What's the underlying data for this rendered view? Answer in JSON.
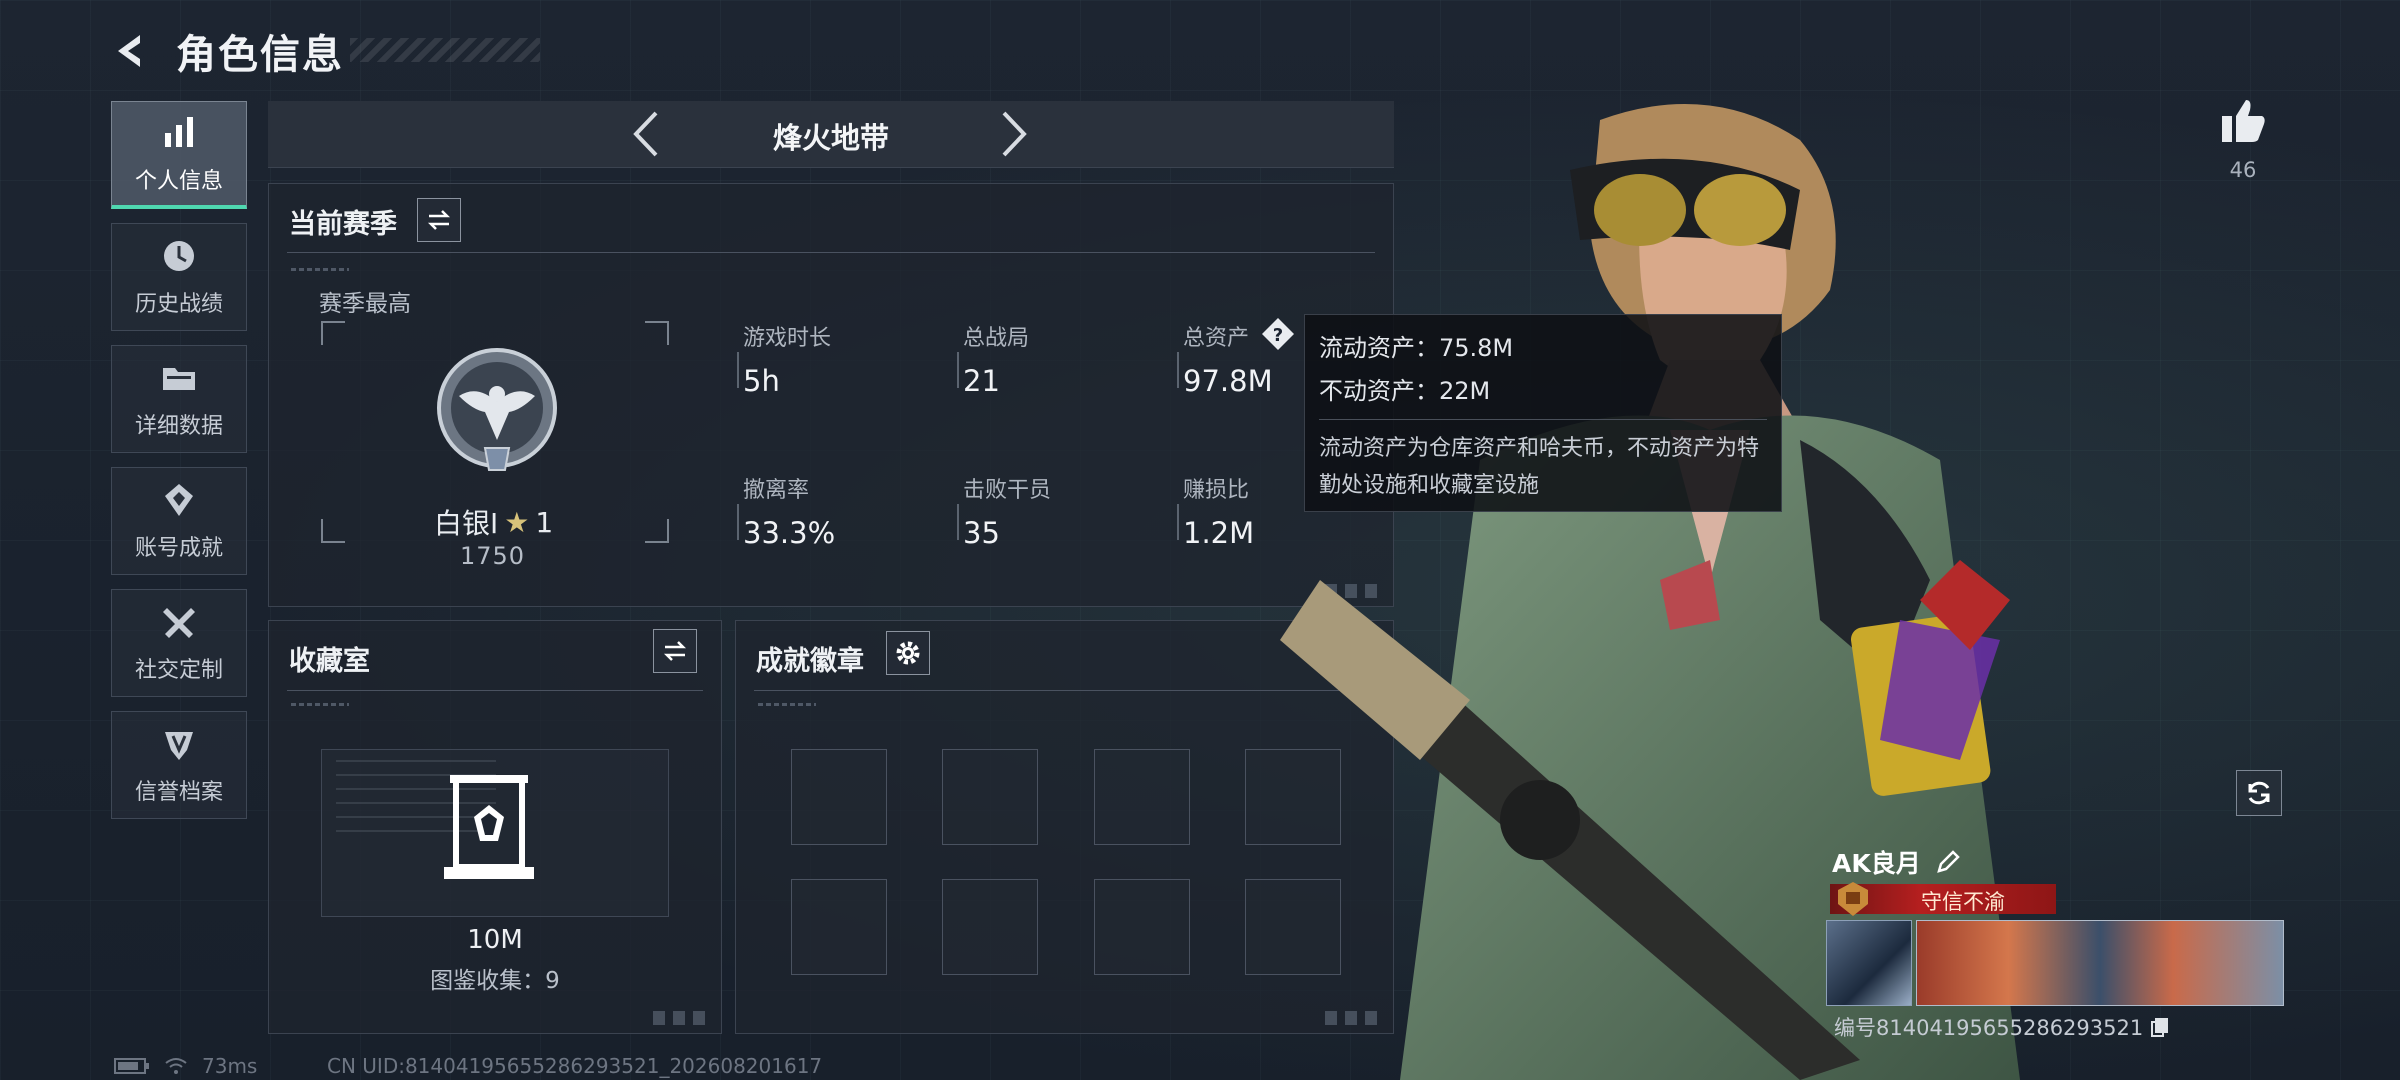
{
  "header": {
    "title": "角色信息"
  },
  "sidebar": {
    "items": [
      {
        "label": "个人信息",
        "icon": "bar-chart-icon",
        "active": true
      },
      {
        "label": "历史战绩",
        "icon": "history-icon",
        "active": false
      },
      {
        "label": "详细数据",
        "icon": "folder-icon",
        "active": false
      },
      {
        "label": "账号成就",
        "icon": "achievement-icon",
        "active": false
      },
      {
        "label": "社交定制",
        "icon": "tools-icon",
        "active": false
      },
      {
        "label": "信誉档案",
        "icon": "credit-icon",
        "active": false
      }
    ]
  },
  "mode": {
    "title": "烽火地带"
  },
  "season": {
    "title": "当前赛季",
    "best_label": "赛季最高",
    "rank_name": "白银I",
    "rank_stars": "1",
    "rank_score": "1750",
    "stats": [
      {
        "label": "游戏时长",
        "value": "5h"
      },
      {
        "label": "总战局",
        "value": "21"
      },
      {
        "label": "总资产",
        "value": "97.8M"
      },
      {
        "label": "撤离率",
        "value": "33.3%"
      },
      {
        "label": "击败干员",
        "value": "35"
      },
      {
        "label": "赚损比",
        "value": "1.2M"
      }
    ]
  },
  "tooltip": {
    "liquid": "流动资产：75.8M",
    "fixed": "不动资产：22M",
    "desc": "流动资产为仓库资产和哈夫币，不动资产为特勤处设施和收藏室设施"
  },
  "collection": {
    "title": "收藏室",
    "value": "10M",
    "count": "图鉴收集：9"
  },
  "achievements": {
    "title": "成就徽章"
  },
  "status": {
    "ping": "73ms",
    "uid": "CN UID:81404195655286293521_202608201617"
  },
  "likes": {
    "count": "46"
  },
  "player": {
    "name": "AK良月",
    "title": "守信不渝",
    "id": "编号81404195655286293521"
  },
  "colors": {
    "accent": "#4fd8b0",
    "title_badge": "#b51f1f",
    "background": "#1b2330"
  }
}
